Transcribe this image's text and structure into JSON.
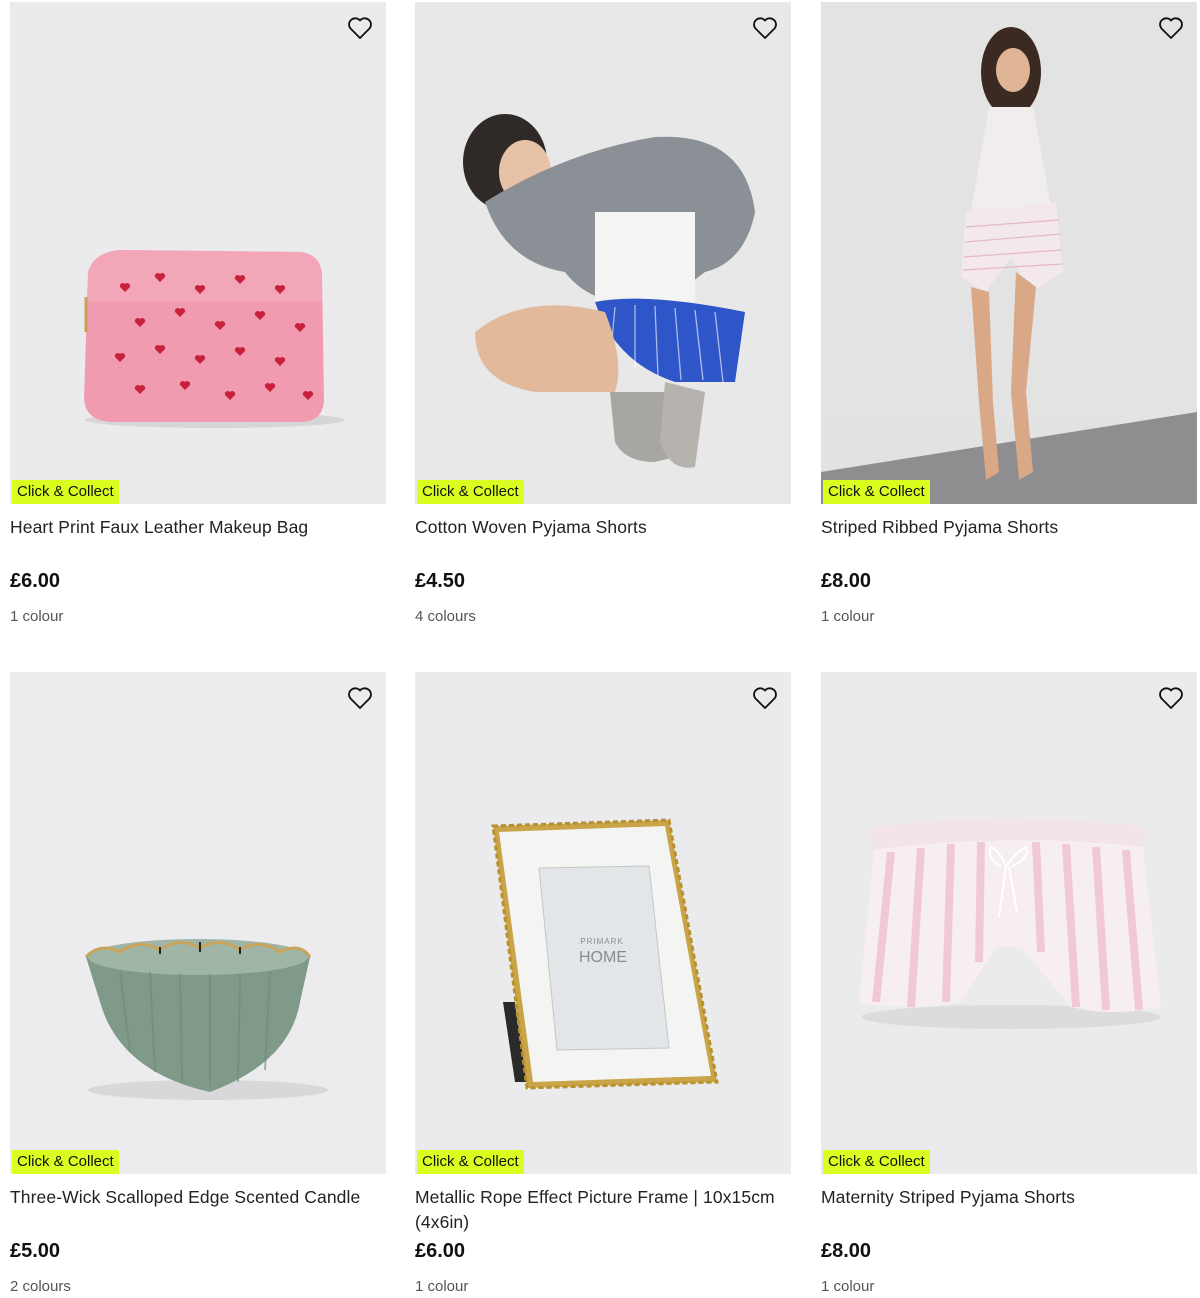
{
  "products": [
    {
      "name": "Heart Print Faux Leather Makeup Bag",
      "badge": "Click & Collect",
      "price": "£6.00",
      "colours": "1 colour"
    },
    {
      "name": "Cotton Woven Pyjama Shorts",
      "badge": "Click & Collect",
      "price": "£4.50",
      "colours": "4 colours"
    },
    {
      "name": "Striped Ribbed Pyjama Shorts",
      "badge": "Click & Collect",
      "price": "£8.00",
      "colours": "1 colour"
    },
    {
      "name": "Three-Wick Scalloped Edge Scented Candle",
      "badge": "Click & Collect",
      "price": "£5.00",
      "colours": "2 colours"
    },
    {
      "name": "Metallic Rope Effect Picture Frame | 10x15cm (4x6in)",
      "badge": "Click & Collect",
      "price": "£6.00",
      "colours": "1 colour"
    },
    {
      "name": "Maternity Striped Pyjama Shorts",
      "badge": "Click & Collect",
      "price": "£8.00",
      "colours": "1 colour"
    }
  ],
  "frame_print": {
    "line1": "PRIMARK",
    "line2": "HOME"
  },
  "icons": {
    "wishlist": "heart-outline-icon"
  },
  "colors": {
    "badge": "#d8ff1f",
    "image_bg": "#ebebed"
  }
}
